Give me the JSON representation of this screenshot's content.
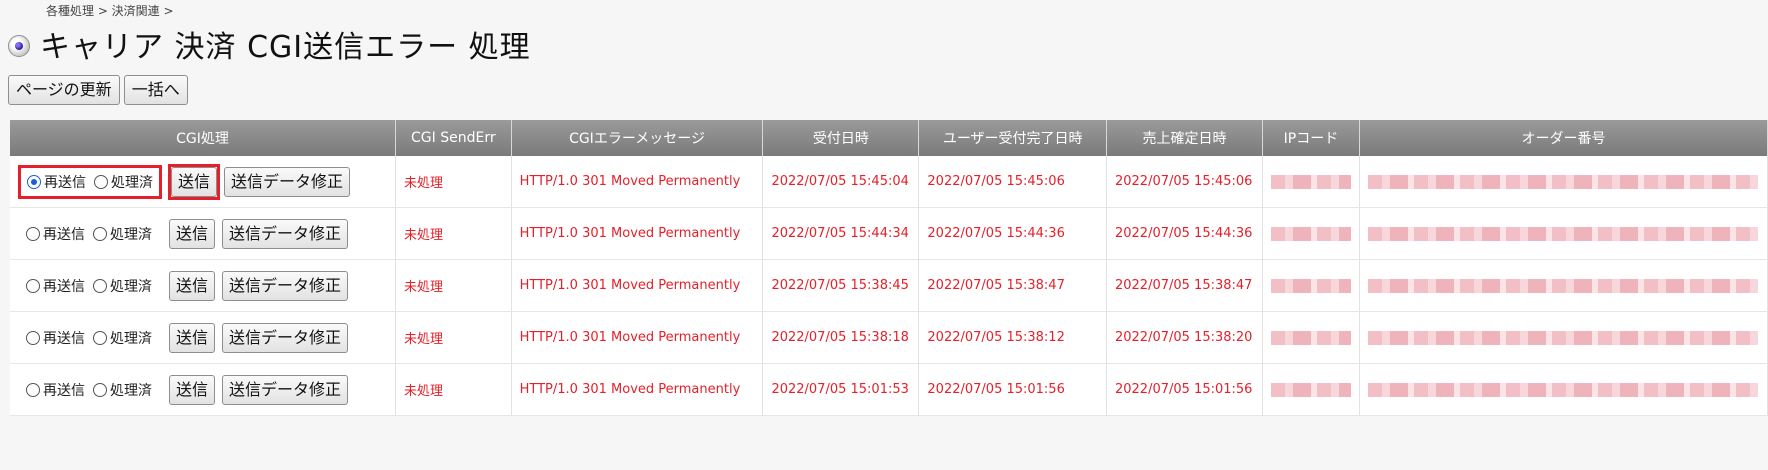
{
  "breadcrumb": "各種処理 > 決済関連 >",
  "page_title": "キャリア 決済 CGI送信エラー 処理",
  "toolbar": {
    "refresh_label": "ページの更新",
    "bulk_label": "一括へ"
  },
  "table": {
    "headers": {
      "cgi_process": "CGI処理",
      "cgi_senderr": "CGI SendErr",
      "cgi_error_message": "CGIエラーメッセージ",
      "received_at": "受付日時",
      "user_completed_at": "ユーザー受付完了日時",
      "sales_confirmed_at": "売上確定日時",
      "ip_code": "IPコード",
      "order_number": "オーダー番号"
    },
    "radio_labels": {
      "resend": "再送信",
      "processed": "処理済"
    },
    "button_labels": {
      "send": "送信",
      "edit_data": "送信データ修正"
    },
    "rows": [
      {
        "resend_checked": true,
        "senderr": "未処理",
        "message": "HTTP/1.0 301 Moved Permanently",
        "received": "2022/07/05 15:45:04",
        "user_completed": "2022/07/05 15:45:06",
        "sales_confirmed": "2022/07/05 15:45:06"
      },
      {
        "resend_checked": false,
        "senderr": "未処理",
        "message": "HTTP/1.0 301 Moved Permanently",
        "received": "2022/07/05 15:44:34",
        "user_completed": "2022/07/05 15:44:36",
        "sales_confirmed": "2022/07/05 15:44:36"
      },
      {
        "resend_checked": false,
        "senderr": "未処理",
        "message": "HTTP/1.0 301 Moved Permanently",
        "received": "2022/07/05 15:38:45",
        "user_completed": "2022/07/05 15:38:47",
        "sales_confirmed": "2022/07/05 15:38:47"
      },
      {
        "resend_checked": false,
        "senderr": "未処理",
        "message": "HTTP/1.0 301 Moved Permanently",
        "received": "2022/07/05 15:38:18",
        "user_completed": "2022/07/05 15:38:12",
        "sales_confirmed": "2022/07/05 15:38:20"
      },
      {
        "resend_checked": false,
        "senderr": "未処理",
        "message": "HTTP/1.0 301 Moved Permanently",
        "received": "2022/07/05 15:01:53",
        "user_completed": "2022/07/05 15:01:56",
        "sales_confirmed": "2022/07/05 15:01:56"
      }
    ]
  },
  "colors": {
    "accent_red": "#e5202a",
    "header_gray": "#8a8a8a",
    "radio_blue": "#1a5fd1"
  },
  "icons": {
    "title_icon": "radio-bullet-icon"
  }
}
